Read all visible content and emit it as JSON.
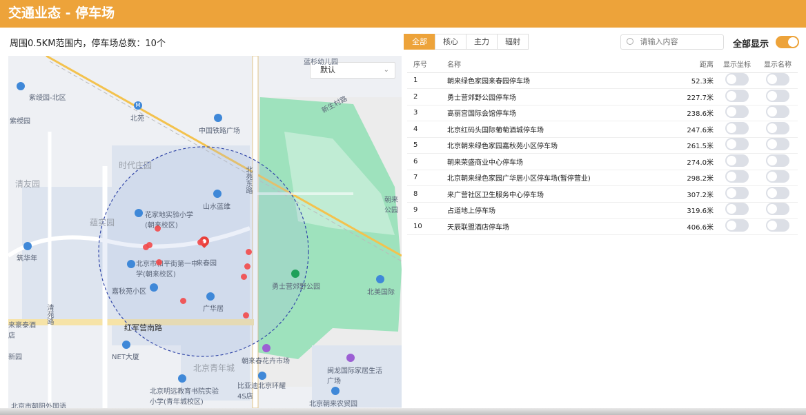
{
  "header": {
    "title": "交通业态 - 停车场"
  },
  "summary": "周围0.5KM范围内，停车场总数：10个",
  "map": {
    "select_value": "默认",
    "labels": {
      "zidy": "紫绶园-北区",
      "zi": "紫绶园",
      "qingyou": "清友园",
      "bei": "北苑",
      "zhongtie": "中国铁路广场",
      "shidai": "时代庄园",
      "xinsheng": "新生村路",
      "beiyuandong": "北苑东路",
      "shanshui": "山水蓝维",
      "huajia": "花家地实验小学(朝来校区)",
      "lanshi": "蕴实园",
      "zhuhua": "筑华年",
      "laichun": "来春园",
      "beijingshi": "北京市和平街第一中学(朝来校区)",
      "yongshi": "勇士营郊野公园",
      "beimeiguo": "北美国际",
      "jiqiu": "嘉秋苑小区",
      "guanghua": "广华居",
      "hongjun": "红军营南路",
      "net": "NET大厦",
      "laiyuan": "来豪泰酒店",
      "xin": "新园",
      "qingyuan": "清苑路",
      "beijingqing": "北京青年城",
      "chaolai": "朝来春花卉市场",
      "minglai": "北京明远教育书院实验小学(青年城校区)",
      "biyadi": "比亚迪北京环耀4S店",
      "yalong": "闽龙国际家居生活广场",
      "nongmao": "北京朝来农贸园",
      "beijingchao": "北京市朝阳外国语",
      "chaolaipark": "朝来公园",
      "weizhu": "蓝杉幼儿园"
    }
  },
  "tabs": [
    "全部",
    "核心",
    "主力",
    "辐射"
  ],
  "search": {
    "placeholder": "请输入内容"
  },
  "all_display": {
    "label": "全部显示",
    "on": true
  },
  "table": {
    "headers": {
      "idx": "序号",
      "name": "名称",
      "dist": "距离",
      "coord": "显示坐标",
      "label": "显示名称"
    },
    "rows": [
      {
        "idx": "1",
        "name": "朝来绿色家园来春园停车场",
        "dist": "52.3米"
      },
      {
        "idx": "2",
        "name": "勇士营郊野公园停车场",
        "dist": "227.7米"
      },
      {
        "idx": "3",
        "name": "高丽宫国际会馆停车场",
        "dist": "238.6米"
      },
      {
        "idx": "4",
        "name": "北京红码头国际葡萄酒城停车场",
        "dist": "247.6米"
      },
      {
        "idx": "5",
        "name": "北京朝来绿色家园嘉秋苑小区停车场",
        "dist": "261.5米"
      },
      {
        "idx": "6",
        "name": "朝来荣盛商业中心停车场",
        "dist": "274.0米"
      },
      {
        "idx": "7",
        "name": "北京朝来绿色家园广华居小区停车场(暂停营业)",
        "dist": "298.2米"
      },
      {
        "idx": "8",
        "name": "来广营社区卫生服务中心停车场",
        "dist": "307.2米"
      },
      {
        "idx": "9",
        "name": "占道地上停车场",
        "dist": "319.6米"
      },
      {
        "idx": "10",
        "name": "天辰联盟酒店停车场",
        "dist": "406.6米"
      }
    ]
  },
  "colors": {
    "accent": "#eda33a",
    "park": "#8fdcb1",
    "dot": "#f2494a"
  }
}
